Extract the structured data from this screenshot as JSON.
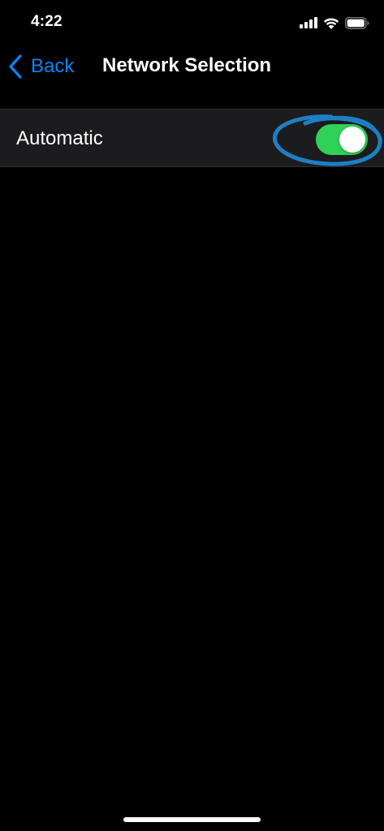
{
  "status_bar": {
    "time": "4:22",
    "icons": [
      "signal-icon",
      "wifi-icon",
      "battery-icon"
    ]
  },
  "nav": {
    "back_label": "Back",
    "title": "Network Selection"
  },
  "settings": {
    "rows": [
      {
        "label": "Automatic",
        "control": "toggle",
        "enabled": true
      }
    ]
  },
  "annotation": {
    "shape": "hand-drawn ellipse around toggle",
    "color": "#1d7fc4"
  },
  "colors": {
    "background": "#000000",
    "row_background": "#1c1c1e",
    "accent": "#0a84ff",
    "toggle_on": "#30d158"
  }
}
